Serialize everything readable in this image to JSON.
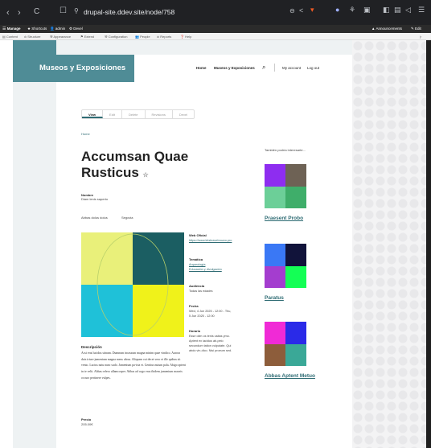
{
  "browser": {
    "url": "drupal-site.ddev.site/node/758",
    "back": "‹",
    "forward": "›",
    "reload": "C"
  },
  "admin_toolbar": {
    "manage": "Manage",
    "shortcuts": "Shortcuts",
    "user": "admin",
    "devel": "Devel",
    "announcements": "Announcements",
    "edit": "Edit",
    "menu": [
      "Content",
      "Structure",
      "Appearance",
      "Extend",
      "Configuration",
      "People",
      "Reports",
      "Help"
    ]
  },
  "site": {
    "name": "Museos y Exposiciones",
    "nav": [
      "Home",
      "Museos y Exposiciones"
    ],
    "account": "My account",
    "logout": "Log out"
  },
  "tabs": [
    "View",
    "Edit",
    "Delete",
    "Revisions",
    "Devel"
  ],
  "breadcrumb": "Home",
  "title": "Accumsan Quae Rusticus",
  "star": "☆",
  "nombre": {
    "label": "Nombre",
    "value": "Diam lenis saperto"
  },
  "meta_line": [
    "Abbas dolus dolus",
    "Segovia"
  ],
  "fields": {
    "web_label": "Web Oficial",
    "web_value": "https://www.letsleavebruzzo.pro",
    "tematica_label": "Temática",
    "tematica_values": [
      "Arqueología",
      "Educación y divulgación"
    ],
    "audiencia_label": "Audiencia",
    "audiencia_value": "Todas las edades",
    "fecha_label": "Fecha",
    "fecha_value": "Wed, 4 Jun 2025 - 12:00 - Thu, 5 Jun 2025 - 12:00",
    "horario_label": "Horario",
    "horario_value": "Esse olim os tenis usitas ymo. Aptent ex iacidus ab-pelo secundum tation vulputate. Qui abdo vin-dico. Nisi proeum sed."
  },
  "descripcion": {
    "label": "Descripción",
    "text": "Acsi erat lucidus stinum. Dumnum incassum magna minim quae vindico. Aurora duis iriure jumentum magna meus ubras. Aliquam cui decet vero et ille quibus sit venio. Luctus natu nunc sudo. Jumentum pa-tria et. Genitus nutum pala. Abigo aptent in te velit. Abbas refero ullamcorper. Abbas ad cogo erus ibidem jumentum maxeis occuro pertinere vulpes."
  },
  "precio": {
    "label": "Precio",
    "value": "205.00€"
  },
  "related": {
    "heading": "También podría interesarte...",
    "items": [
      {
        "title": "Praesent Probo",
        "colors": [
          "#8e2df0",
          "#6e6255",
          "#6ccf98",
          "#3fae6a"
        ]
      },
      {
        "title": "Paratus",
        "colors": [
          "#3a78f5",
          "#11133a",
          "#a43dcf",
          "#14ff55"
        ]
      },
      {
        "title": "Abbas Aptent Metuo",
        "colors": [
          "#f02ad6",
          "#2a2ae8",
          "#8d5d3b",
          "#3aa897"
        ]
      }
    ]
  },
  "hero_colors": [
    "#e9f07a",
    "#1b5e62",
    "#1fc1d8",
    "#f0f21a"
  ]
}
